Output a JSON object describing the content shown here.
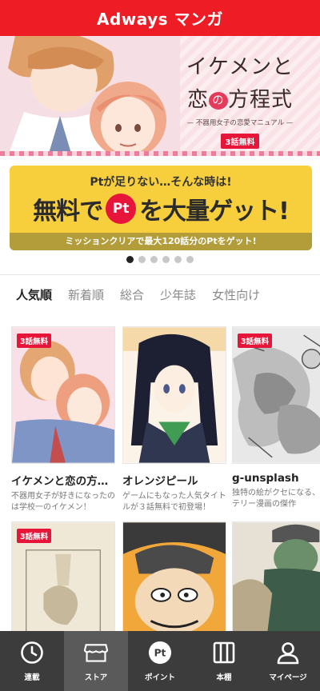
{
  "header": {
    "title": "Adways マンガ"
  },
  "hero": {
    "title_line1": "イケメンと",
    "title_line2_a": "恋",
    "title_line2_heart": "の",
    "title_line2_b": "方程式",
    "subtitle": "— 不器用女子の恋愛マニュアル —",
    "badge": "3話無料"
  },
  "promo": {
    "line1": "Ptが足りない…そんな時は!",
    "line2_a": "無料で",
    "pt": "Pt",
    "line2_b": "を大量ゲット!",
    "bottom": "ミッションクリアで最大120話分のPtをゲット!"
  },
  "carousel": {
    "count": 6,
    "active_index": 0
  },
  "tabs": [
    {
      "label": "人気順",
      "active": true
    },
    {
      "label": "新着順",
      "active": false
    },
    {
      "label": "総合",
      "active": false
    },
    {
      "label": "少年誌",
      "active": false
    },
    {
      "label": "女性向け",
      "active": false
    }
  ],
  "comics": [
    {
      "title": "イケメンと恋の方程式",
      "desc": "不器用女子が好きになったのは学校一のイケメン！",
      "badge": "3話無料"
    },
    {
      "title": "オレンジピール",
      "desc": "ゲームにもなった人気タイトルが３話無料で初登場！",
      "badge": ""
    },
    {
      "title": "g-unsplash",
      "desc": "独特の絵がクセになる、ミステリー漫画の傑作",
      "badge": "3話無料"
    },
    {
      "title": "",
      "desc": "",
      "badge": "3話無料"
    },
    {
      "title": "",
      "desc": "",
      "badge": ""
    },
    {
      "title": "",
      "desc": "",
      "badge": ""
    }
  ],
  "bottom_nav": [
    {
      "label": "連載",
      "icon": "clock-icon",
      "active": false
    },
    {
      "label": "ストア",
      "icon": "store-icon",
      "active": true
    },
    {
      "label": "ポイント",
      "icon": "pt-icon",
      "active": false
    },
    {
      "label": "本棚",
      "icon": "bookshelf-icon",
      "active": false
    },
    {
      "label": "マイページ",
      "icon": "user-icon",
      "active": false
    }
  ],
  "colors": {
    "brand_red": "#ee1c25",
    "promo_yellow": "#f7cf3d",
    "nav_bg": "#3c3c3c",
    "nav_active": "#5a5a5a"
  }
}
